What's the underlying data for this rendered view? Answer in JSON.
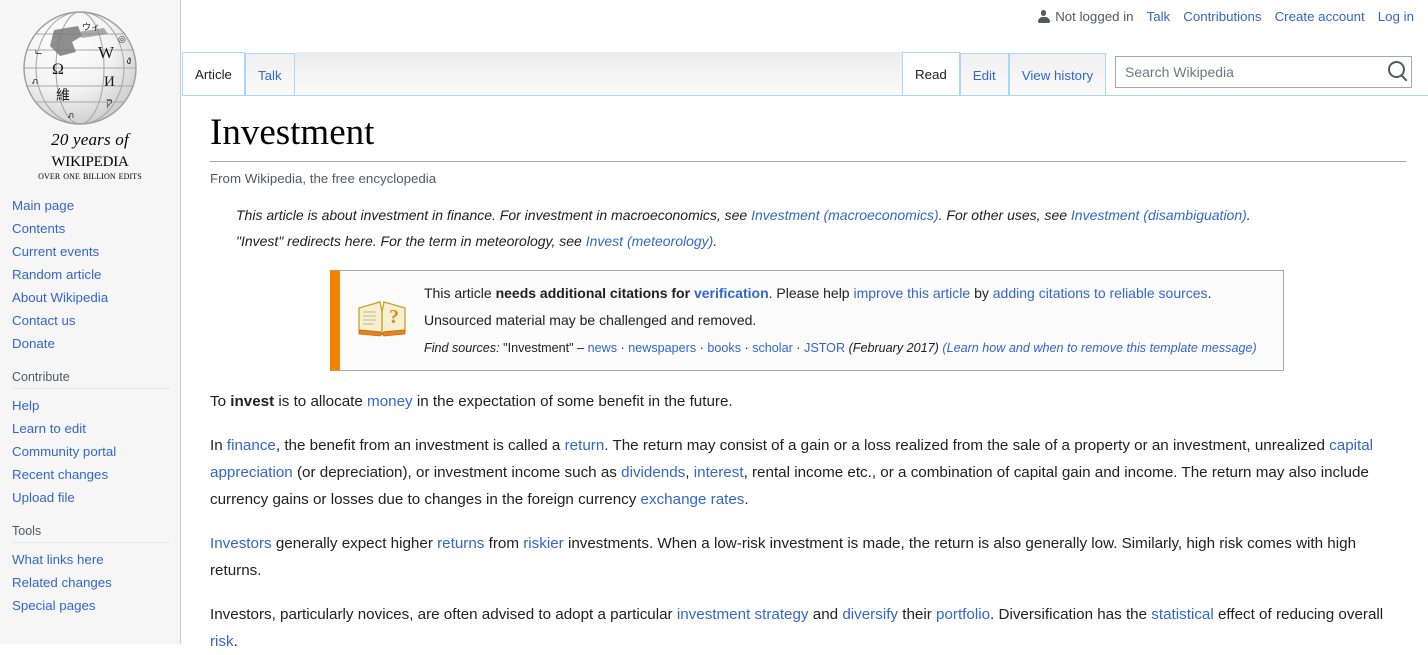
{
  "personal_bar": {
    "user_icon": "user-icon",
    "items": [
      {
        "label": "Not logged in",
        "type": "status"
      },
      {
        "label": "Talk",
        "type": "link"
      },
      {
        "label": "Contributions",
        "type": "link"
      },
      {
        "label": "Create account",
        "type": "link"
      },
      {
        "label": "Log in",
        "type": "link"
      }
    ]
  },
  "logo": {
    "icon": "wikipedia-globe-icon",
    "tagline_top": "20 years of",
    "wordmark": "Wikipedia",
    "tagline_bottom": "Over One Billion Edits"
  },
  "sidebar": {
    "portals": [
      {
        "heading": "",
        "items": [
          "Main page",
          "Contents",
          "Current events",
          "Random article",
          "About Wikipedia",
          "Contact us",
          "Donate"
        ]
      },
      {
        "heading": "Contribute",
        "items": [
          "Help",
          "Learn to edit",
          "Community portal",
          "Recent changes",
          "Upload file"
        ]
      },
      {
        "heading": "Tools",
        "items": [
          "What links here",
          "Related changes",
          "Special pages"
        ]
      }
    ]
  },
  "tabs": {
    "namespace": [
      {
        "label": "Article",
        "selected": true
      },
      {
        "label": "Talk",
        "selected": false
      }
    ],
    "views": [
      {
        "label": "Read",
        "selected": true
      },
      {
        "label": "Edit",
        "selected": false
      },
      {
        "label": "View history",
        "selected": false
      }
    ]
  },
  "search": {
    "placeholder": "Search Wikipedia",
    "value": "",
    "button_icon": "search-icon"
  },
  "article": {
    "title": "Investment",
    "site_sub": "From Wikipedia, the free encyclopedia",
    "hatnote_1": {
      "text_a": "This article is about investment in finance. For investment in macroeconomics, see ",
      "link_a": "Investment (macroeconomics)",
      "text_b": ". For other uses, see ",
      "link_b": "Investment (disambiguation)",
      "text_c": "."
    },
    "hatnote_2": {
      "text_a": "\"Invest\" redirects here. For the term in meteorology, see ",
      "link_a": "Invest (meteorology)",
      "text_b": "."
    },
    "ambox": {
      "icon": "open-book-question-icon",
      "accent_color": "#f28500",
      "line1_a": "This article ",
      "line1_bold": "needs additional citations for ",
      "line1_link1": "verification",
      "line1_b": ". Please help ",
      "line1_link2": "improve this article",
      "line1_c": " by ",
      "line1_link3": "adding citations to reliable sources",
      "line1_d": ". Unsourced material may be challenged and removed.",
      "find_sources_label": "Find sources:",
      "find_sources_query": "\"Investment\"",
      "find_sources_dash": "–",
      "find_sources_links": [
        "news",
        "newspapers",
        "books",
        "scholar",
        "JSTOR"
      ],
      "date": "(February 2017)",
      "learn_more": "(Learn how and when to remove this template message)"
    },
    "paragraphs": [
      {
        "id": "p1",
        "runs": [
          {
            "t": "To ",
            "k": "text"
          },
          {
            "t": "invest",
            "k": "bold"
          },
          {
            "t": " is to allocate ",
            "k": "text"
          },
          {
            "t": "money",
            "k": "link"
          },
          {
            "t": " in the expectation of some benefit in the future.",
            "k": "text"
          }
        ]
      },
      {
        "id": "p2",
        "runs": [
          {
            "t": "In ",
            "k": "text"
          },
          {
            "t": "finance",
            "k": "link"
          },
          {
            "t": ", the benefit from an investment is called a ",
            "k": "text"
          },
          {
            "t": "return",
            "k": "link"
          },
          {
            "t": ". The return may consist of a gain or a loss realized from the sale of a property or an investment, unrealized ",
            "k": "text"
          },
          {
            "t": "capital appreciation",
            "k": "link"
          },
          {
            "t": " (or depreciation), or investment income such as ",
            "k": "text"
          },
          {
            "t": "dividends",
            "k": "link"
          },
          {
            "t": ", ",
            "k": "text"
          },
          {
            "t": "interest",
            "k": "link"
          },
          {
            "t": ", rental income etc., or a combination of capital gain and income. The return may also include currency gains or losses due to changes in the foreign currency ",
            "k": "text"
          },
          {
            "t": "exchange rates",
            "k": "link"
          },
          {
            "t": ".",
            "k": "text"
          }
        ]
      },
      {
        "id": "p3",
        "runs": [
          {
            "t": "Investors",
            "k": "link"
          },
          {
            "t": " generally expect higher ",
            "k": "text"
          },
          {
            "t": "returns",
            "k": "link"
          },
          {
            "t": " from ",
            "k": "text"
          },
          {
            "t": "riskier",
            "k": "link"
          },
          {
            "t": " investments. When a low-risk investment is made, the return is also generally low. Similarly, high risk comes with high returns.",
            "k": "text"
          }
        ]
      },
      {
        "id": "p4",
        "runs": [
          {
            "t": "Investors, particularly novices, are often advised to adopt a particular ",
            "k": "text"
          },
          {
            "t": "investment strategy",
            "k": "link"
          },
          {
            "t": " and ",
            "k": "text"
          },
          {
            "t": "diversify",
            "k": "link"
          },
          {
            "t": " their ",
            "k": "text"
          },
          {
            "t": "portfolio",
            "k": "link"
          },
          {
            "t": ". Diversification has the ",
            "k": "text"
          },
          {
            "t": "statistical",
            "k": "link"
          },
          {
            "t": " effect of reducing overall ",
            "k": "text"
          },
          {
            "t": "risk",
            "k": "link"
          },
          {
            "t": ".",
            "k": "text"
          }
        ]
      }
    ]
  },
  "colors": {
    "link": "#3366cc",
    "sidebar_bg": "#f6f6f6",
    "tab_border": "#a7d7f9",
    "ambox_accent": "#f28500",
    "text": "#202122"
  }
}
